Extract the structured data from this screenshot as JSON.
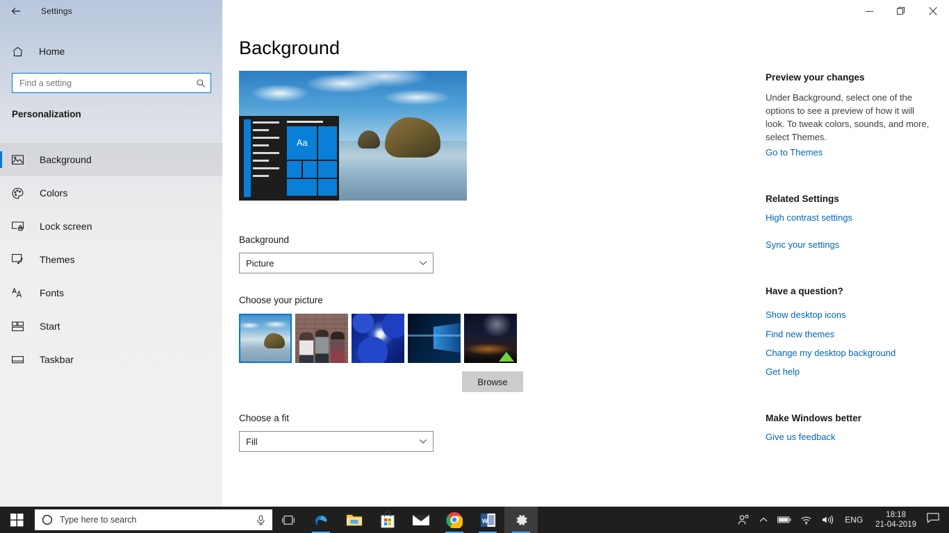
{
  "window": {
    "title": "Settings",
    "back_icon": "back-arrow-icon",
    "minimize_label": "Minimize",
    "restore_label": "Restore",
    "close_label": "Close"
  },
  "sidebar": {
    "home_label": "Home",
    "home_icon": "home-icon",
    "search": {
      "placeholder": "Find a setting",
      "value": "",
      "icon": "search-icon"
    },
    "category": "Personalization",
    "items": [
      {
        "label": "Background",
        "icon": "image-icon",
        "selected": true
      },
      {
        "label": "Colors",
        "icon": "palette-icon",
        "selected": false
      },
      {
        "label": "Lock screen",
        "icon": "lock-screen-icon",
        "selected": false
      },
      {
        "label": "Themes",
        "icon": "brush-icon",
        "selected": false
      },
      {
        "label": "Fonts",
        "icon": "fonts-icon",
        "selected": false
      },
      {
        "label": "Start",
        "icon": "start-icon",
        "selected": false
      },
      {
        "label": "Taskbar",
        "icon": "taskbar-icon",
        "selected": false
      }
    ]
  },
  "main": {
    "page_title": "Background",
    "preview": {
      "name": "desktop-preview",
      "tile_text": "Aa"
    },
    "background_label": "Background",
    "background_value": "Picture",
    "choose_picture_label": "Choose your picture",
    "thumbnails": [
      {
        "name": "thumbnail-beach",
        "alt": "Beach with rock arch",
        "selected": true
      },
      {
        "name": "thumbnail-people",
        "alt": "Three people by brick wall",
        "selected": false
      },
      {
        "name": "thumbnail-spheres",
        "alt": "Blue abstract spheres",
        "selected": false
      },
      {
        "name": "thumbnail-hero",
        "alt": "Windows 10 hero logo",
        "selected": false
      },
      {
        "name": "thumbnail-night",
        "alt": "Night sky with tent",
        "selected": false
      }
    ],
    "browse_label": "Browse",
    "fit_label": "Choose a fit",
    "fit_value": "Fill"
  },
  "right_panel": {
    "preview_heading": "Preview your changes",
    "preview_body": "Under Background, select one of the options to see a preview of how it will look. To tweak colors, sounds, and more, select Themes.",
    "preview_link": "Go to Themes",
    "related_heading": "Related Settings",
    "related_links": [
      "High contrast settings",
      "Sync your settings"
    ],
    "question_heading": "Have a question?",
    "question_links": [
      "Show desktop icons",
      "Find new themes",
      "Change my desktop background",
      "Get help"
    ],
    "better_heading": "Make Windows better",
    "better_link": "Give us feedback"
  },
  "taskbar": {
    "start_icon": "windows-start-icon",
    "search_placeholder": "Type here to search",
    "search_icon": "cortana-circle-icon",
    "mic_icon": "microphone-icon",
    "taskview_icon": "task-view-icon",
    "apps": [
      {
        "name": "edge-icon",
        "label": "Microsoft Edge",
        "open": true,
        "active": false
      },
      {
        "name": "explorer-icon",
        "label": "File Explorer",
        "open": false,
        "active": false
      },
      {
        "name": "store-icon",
        "label": "Microsoft Store",
        "open": false,
        "active": false
      },
      {
        "name": "mail-icon",
        "label": "Mail",
        "open": false,
        "active": false
      },
      {
        "name": "chrome-icon",
        "label": "Google Chrome",
        "open": true,
        "active": false
      },
      {
        "name": "word-icon",
        "label": "Microsoft Word",
        "open": true,
        "active": false
      },
      {
        "name": "settings-icon",
        "label": "Settings",
        "open": true,
        "active": true
      }
    ],
    "tray": {
      "people_icon": "people-icon",
      "chevron_icon": "show-hidden-icons-icon",
      "battery_icon": "battery-icon",
      "network_icon": "wifi-icon",
      "volume_icon": "volume-icon",
      "language": "ENG",
      "time": "18:18",
      "date": "21-04-2019",
      "action_center_icon": "action-center-icon"
    }
  },
  "colors": {
    "accent": "#0078d7",
    "link": "#0067b8",
    "taskbar_bg": "#1f1f1f",
    "sidebar_bg": "#f0f0f0"
  }
}
